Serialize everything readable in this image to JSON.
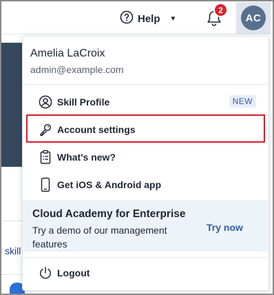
{
  "header": {
    "help_label": "Help",
    "notification_count": "2",
    "avatar_initials": "AC"
  },
  "background": {
    "partial_text": "l skill"
  },
  "menu": {
    "user_name": "Amelia LaCroix",
    "user_email": "admin@example.com",
    "items": [
      {
        "label": "Skill Profile",
        "icon": "user-circle-icon",
        "tag": "NEW"
      },
      {
        "label": "Account settings",
        "icon": "key-icon"
      },
      {
        "label": "What's new?",
        "icon": "clipboard-icon"
      },
      {
        "label": "Get iOS & Android app",
        "icon": "phone-icon"
      }
    ],
    "promo": {
      "title": "Cloud Academy for Enterprise",
      "subtitle": "Try a demo of our management features",
      "cta": "Try now"
    },
    "logout_label": "Logout"
  },
  "colors": {
    "highlight": "#d11f2b",
    "badge": "#d9232e",
    "avatar": "#56708e",
    "link": "#2f5ea8",
    "promo_bg": "#eef3fa"
  }
}
